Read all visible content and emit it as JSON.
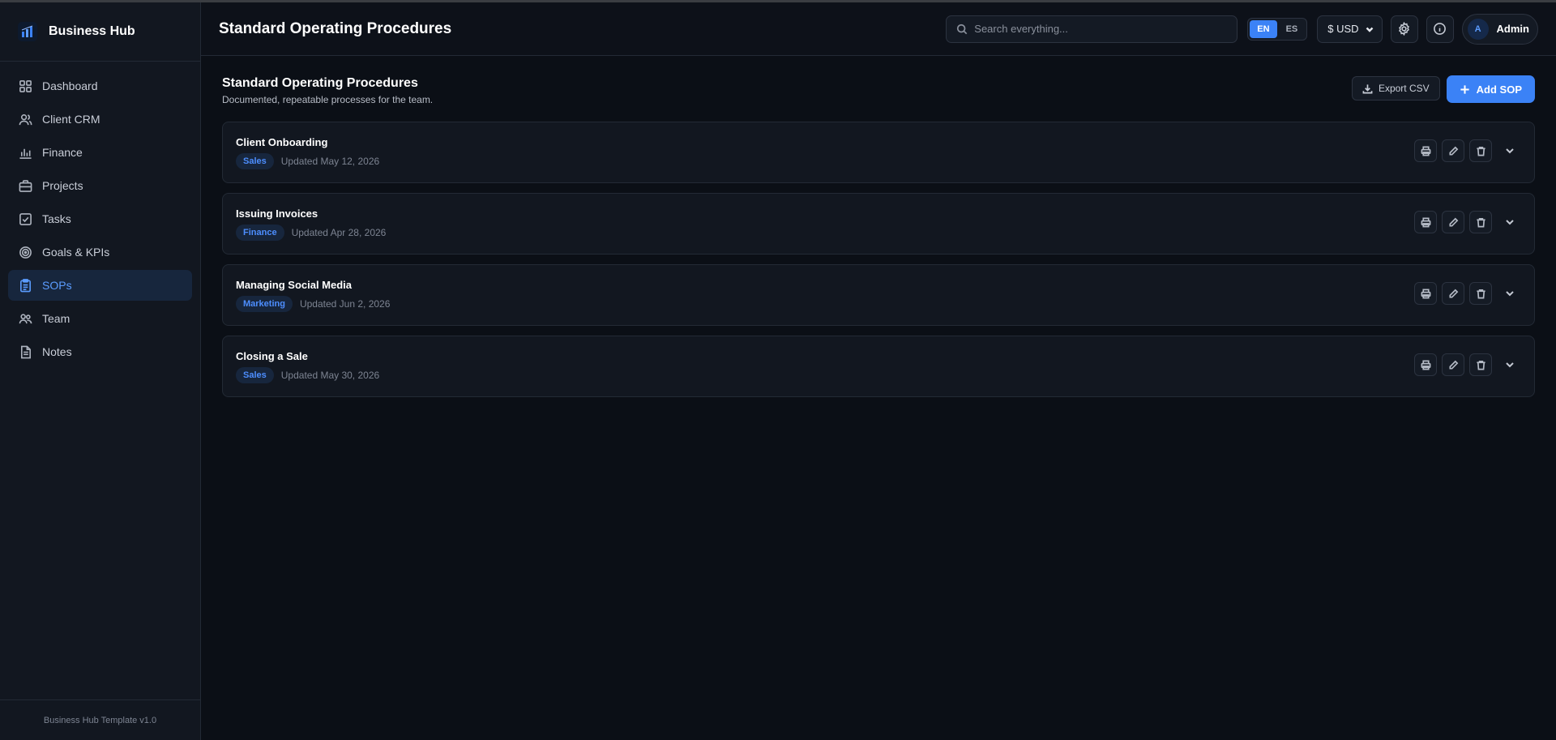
{
  "brand": {
    "name": "Business Hub"
  },
  "sidebar": {
    "items": [
      {
        "label": "Dashboard",
        "icon": "dashboard-icon",
        "active": false
      },
      {
        "label": "Client CRM",
        "icon": "users-icon",
        "active": false
      },
      {
        "label": "Finance",
        "icon": "bar-chart-icon",
        "active": false
      },
      {
        "label": "Projects",
        "icon": "briefcase-icon",
        "active": false
      },
      {
        "label": "Tasks",
        "icon": "checkbox-icon",
        "active": false
      },
      {
        "label": "Goals & KPIs",
        "icon": "target-icon",
        "active": false
      },
      {
        "label": "SOPs",
        "icon": "clipboard-icon",
        "active": true
      },
      {
        "label": "Team",
        "icon": "team-icon",
        "active": false
      },
      {
        "label": "Notes",
        "icon": "note-icon",
        "active": false
      }
    ],
    "footer": "Business Hub Template v1.0"
  },
  "header": {
    "title": "Standard Operating Procedures",
    "search_placeholder": "Search everything...",
    "lang": {
      "en": "EN",
      "es": "ES",
      "active": "EN"
    },
    "currency": "$ USD",
    "user": {
      "initial": "A",
      "name": "Admin"
    }
  },
  "section": {
    "title": "Standard Operating Procedures",
    "subtitle": "Documented, repeatable processes for the team.",
    "export_label": "Export CSV",
    "add_label": "Add SOP"
  },
  "sops": [
    {
      "title": "Client Onboarding",
      "category": "Sales",
      "updated": "Updated May 12, 2026"
    },
    {
      "title": "Issuing Invoices",
      "category": "Finance",
      "updated": "Updated Apr 28, 2026"
    },
    {
      "title": "Managing Social Media",
      "category": "Marketing",
      "updated": "Updated Jun 2, 2026"
    },
    {
      "title": "Closing a Sale",
      "category": "Sales",
      "updated": "Updated May 30, 2026"
    }
  ],
  "colors": {
    "accent": "#3b82f6",
    "background": "#0b0f16",
    "sidebar": "#121720",
    "active_nav_bg": "#17263d"
  }
}
